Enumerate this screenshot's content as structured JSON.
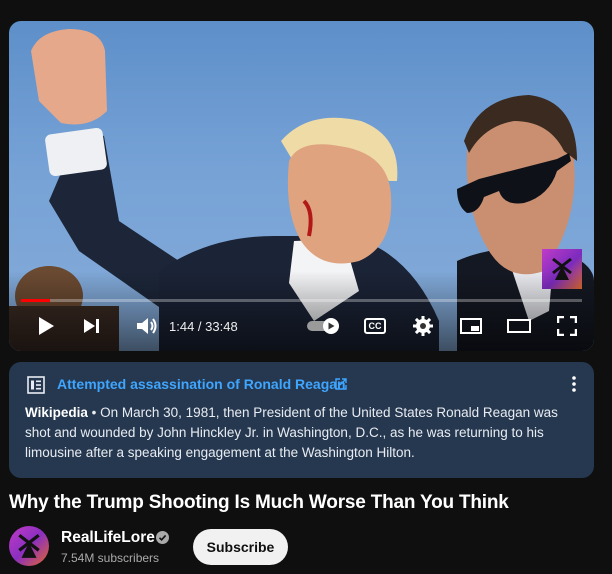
{
  "player": {
    "time_display": "1:44 / 33:48",
    "progress_fraction": 0.051,
    "subtitles_label": "CC"
  },
  "info_panel": {
    "title": "Attempted assassination of Ronald Reagan",
    "source": "Wikipedia",
    "separator": " • ",
    "text": "On March 30, 1981, then President of the United States Ronald Reagan was shot and wounded by John Hinckley Jr. in Washington, D.C., as he was returning to his limousine after a speaking engagement at the Washington Hilton."
  },
  "video": {
    "title": "Why the Trump Shooting Is Much Worse Than You Think"
  },
  "channel": {
    "name": "RealLifeLore",
    "subscribers": "7.54M subscribers",
    "subscribe_label": "Subscribe"
  },
  "colors": {
    "progress": "#ff0000",
    "info_link": "#3ea6ff",
    "info_card_bg": "#263850",
    "page_bg": "#0f0f0f"
  },
  "icons": [
    "play-icon",
    "next-icon",
    "volume-icon",
    "autoplay-toggle-icon",
    "subtitles-icon",
    "settings-icon",
    "miniplayer-icon",
    "theater-icon",
    "fullscreen-icon",
    "wikipedia-info-icon",
    "external-link-icon",
    "more-vert-icon",
    "verified-icon",
    "channel-logo-icon"
  ]
}
